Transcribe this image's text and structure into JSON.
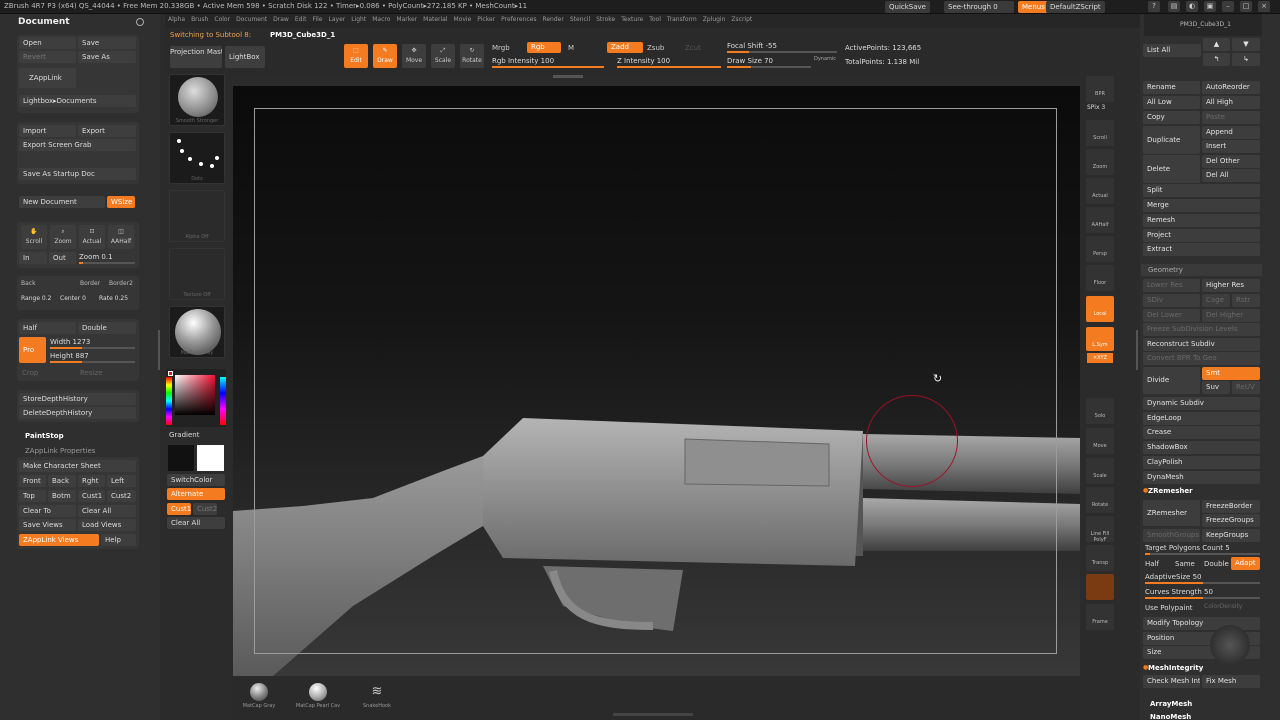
{
  "topbar": {
    "title": "ZBrush 4R7 P3 (x64)   QS_44044   • Free Mem 20.338GB • Active Mem 598 • Scratch Disk 122 • Timer▸0.086 • PolyCount▸272.185 KP • MeshCount▸11",
    "quicksave": "QuickSave",
    "seethrough": "See-through  0",
    "menus": "Menus",
    "script": "DefaultZScript"
  },
  "menubar": [
    "Alpha",
    "Brush",
    "Color",
    "Document",
    "Draw",
    "Edit",
    "File",
    "Layer",
    "Light",
    "Macro",
    "Marker",
    "Material",
    "Movie",
    "Picker",
    "Preferences",
    "Render",
    "Stencil",
    "Stroke",
    "Texture",
    "Tool",
    "Transform",
    "Zplugin",
    "Zscript"
  ],
  "menubar_first": "Alpha",
  "left": {
    "title": "Document",
    "open": "Open",
    "save": "Save",
    "revert": "Revert",
    "saveas": "Save As",
    "zapplink": "ZAppLink",
    "lightbox_docs": "Lightbox▸Documents",
    "import": "Import",
    "export": "Export",
    "export_screen": "Export Screen Grab",
    "save_startup": "Save As Startup Doc",
    "new_doc": "New Document",
    "wsize": "WSize",
    "scroll": "Scroll",
    "zoom": "Zoom",
    "actual": "Actual",
    "aahalf": "AAHalf",
    "in": "In",
    "out": "Out",
    "zoom_val": "Zoom 0.1",
    "back": "Back",
    "border": "Border",
    "border2": "Border2",
    "range": "Range 0.2",
    "center": "Center 0",
    "rate": "Rate 0.25",
    "half": "Half",
    "double": "Double",
    "pro": "Pro",
    "width": "Width 1273",
    "height": "Height 887",
    "crop": "Crop",
    "resize": "Resize",
    "store_depth": "StoreDepthHistory",
    "delete_depth": "DeleteDepthHistory",
    "paintstop": "PaintStop",
    "zapplink_props": "ZAppLink Properties",
    "make_sheet": "Make Character Sheet",
    "front": "Front",
    "back2": "Back",
    "right": "Rght",
    "leftv": "Left",
    "top": "Top",
    "botm": "Botm",
    "cust1": "Cust1",
    "cust2": "Cust2",
    "clear_to": "Clear To",
    "clear_all": "Clear All",
    "save_views": "Save Views",
    "load_views": "Load Views",
    "zapplink_views": "ZAppLink Views",
    "help": "Help"
  },
  "shelf": {
    "switching": "Switching to Subtool 8:",
    "subtool": "PM3D_Cube3D_1",
    "projection_master": "Projection Master",
    "lightbox": "LightBox",
    "edit": "Edit",
    "draw": "Draw",
    "move": "Move",
    "scale": "Scale",
    "rotate": "Rotate",
    "mrgb": "Mrgb",
    "rgb": "Rgb",
    "m": "M",
    "rgb_intensity": "Rgb Intensity 100",
    "zadd": "Zadd",
    "zsub": "Zsub",
    "zcut": "Zcut",
    "z_intensity": "Z Intensity 100",
    "focal_shift": "Focal Shift -55",
    "draw_size": "Draw Size 70",
    "dynamic": "Dynamic",
    "active_points": "ActivePoints: 123,665",
    "total_points": "TotalPoints: 1.138 Mil",
    "rgb_intensity_fraction": 1.0,
    "z_intensity_fraction": 1.0
  },
  "trays": {
    "brush": "Smooth Stronger",
    "stroke": "Dots",
    "alpha": "Alpha Off",
    "texture": "Texture Off",
    "material": "MatCap Gray",
    "gradient": "Gradient",
    "switchcolor": "SwitchColor",
    "alternate": "Alternate",
    "cust1": "Cust1",
    "cust2": "Cust2",
    "clear_all": "Clear All"
  },
  "rightstrip": [
    "BPR",
    "SPix 3",
    "Scroll",
    "Zoom",
    "Actual",
    "AAHalf",
    "Persp",
    "Floor",
    "Local",
    "L.Sym",
    "XYZ",
    "",
    "",
    "Solo",
    "Move",
    "Scale",
    "Rotate",
    "Line Fill PolyF",
    "Transp",
    "Ghost",
    "Frame"
  ],
  "rightstrip_labels": {
    "bpr": "BPR",
    "spix": "SPix 3",
    "scroll": "Scroll",
    "zoom": "Zoom",
    "actual": "Actual",
    "aahalf": "AAHalf",
    "persp": "Persp",
    "floor": "Floor",
    "local": "Local",
    "lsym": "L.Sym",
    "xyz": "✕XYZ",
    "solo": "Solo",
    "move": "Move",
    "scale": "Scale",
    "rotate": "Rotate",
    "polyf": "Line Fill PolyF",
    "transp": "Transp",
    "frame": "Frame"
  },
  "right": {
    "subtool_name": "PM3D_Cube3D_1",
    "list_all": "List All",
    "rename": "Rename",
    "autoreorder": "AutoReorder",
    "all_low": "All Low",
    "all_high": "All High",
    "copy": "Copy",
    "paste": "Paste",
    "duplicate": "Duplicate",
    "append": "Append",
    "insert": "Insert",
    "delete": "Delete",
    "del_other": "Del Other",
    "del_all": "Del All",
    "split": "Split",
    "merge": "Merge",
    "remesh": "Remesh",
    "project": "Project",
    "extract": "Extract",
    "geometry": "Geometry",
    "lower_res": "Lower Res",
    "higher_res": "Higher Res",
    "sdiv": "SDiv",
    "cage": "Cage",
    "rstr": "Rstr",
    "del_lower": "Del Lower",
    "del_higher": "Del Higher",
    "freeze_sub": "Freeze SubDivision Levels",
    "reconstruct": "Reconstruct Subdiv",
    "convert_bpr": "Convert BPR To Geo",
    "divide": "Divide",
    "smt": "Smt",
    "suv": "Suv",
    "reuv": "ReUV",
    "dynamic_subdiv": "Dynamic Subdiv",
    "edgeloop": "EdgeLoop",
    "crease": "Crease",
    "shadowbox": "ShadowBox",
    "claypolish": "ClayPolish",
    "dynamesh": "DynaMesh",
    "zremesher_hdr": "ZRemesher",
    "zremesher": "ZRemesher",
    "freeze_border": "FreezeBorder",
    "freeze_groups": "FreezeGroups",
    "smooth_groups": "SmoothGroups",
    "keep_groups": "KeepGroups",
    "target_polys": "Target Polygons Count 5",
    "half": "Half",
    "same": "Same",
    "double": "Double",
    "adapt": "Adapt",
    "adaptive_size": "AdaptiveSize 50",
    "curves_strength": "Curves Strength 50",
    "use_polypaint": "Use Polypaint",
    "color_density": "ColorDensity",
    "modify_topology": "Modify Topology",
    "position": "Position",
    "size": "Size",
    "meshintegrity": "MeshIntegrity",
    "check_mesh": "Check Mesh Int",
    "fix_mesh": "Fix Mesh",
    "arraymesh": "ArrayMesh",
    "nanomesh": "NanoMesh"
  },
  "bottom": {
    "mat1": "MatCap Gray",
    "mat2": "MatCap Pearl Cav",
    "mat3": "SnakeHook"
  },
  "colors": {
    "accent": "#f47b20",
    "panel": "#2f2f2f",
    "canvas_top": "#0b0b0b"
  }
}
